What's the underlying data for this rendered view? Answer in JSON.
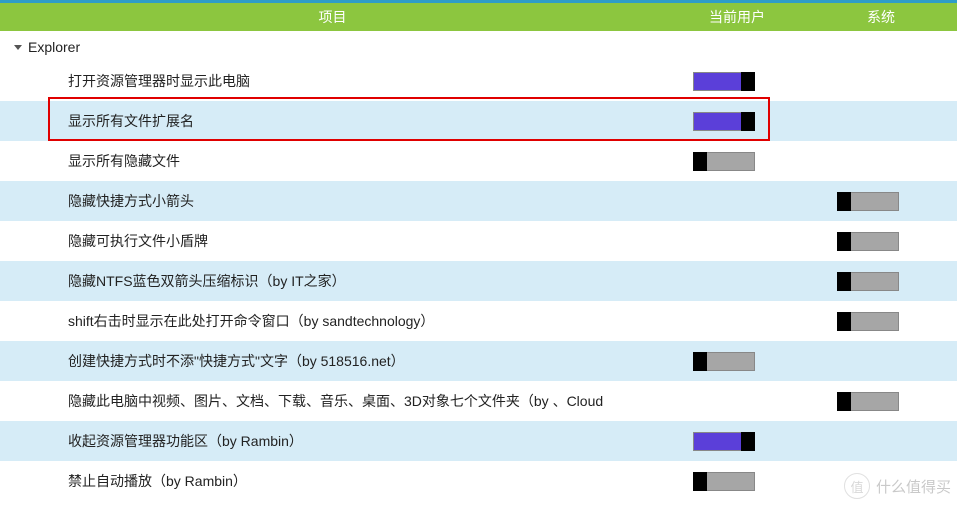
{
  "header": {
    "item": "项目",
    "user": "当前用户",
    "system": "系统"
  },
  "section": {
    "title": "Explorer"
  },
  "rows": [
    {
      "label": "打开资源管理器时显示此电脑",
      "user": "on",
      "sys": null,
      "alt": false
    },
    {
      "label": "显示所有文件扩展名",
      "user": "on",
      "sys": null,
      "alt": true
    },
    {
      "label": "显示所有隐藏文件",
      "user": "off",
      "sys": null,
      "alt": false
    },
    {
      "label": "隐藏快捷方式小箭头",
      "user": null,
      "sys": "off",
      "alt": true
    },
    {
      "label": "隐藏可执行文件小盾牌",
      "user": null,
      "sys": "off",
      "alt": false
    },
    {
      "label": "隐藏NTFS蓝色双箭头压缩标识（by IT之家）",
      "user": null,
      "sys": "off",
      "alt": true
    },
    {
      "label": "shift右击时显示在此处打开命令窗口（by sandtechnology）",
      "user": null,
      "sys": "off",
      "alt": false
    },
    {
      "label": "创建快捷方式时不添\"快捷方式\"文字（by 518516.net）",
      "user": "off",
      "sys": null,
      "alt": true
    },
    {
      "label": "隐藏此电脑中视频、图片、文档、下载、音乐、桌面、3D对象七个文件夹（by 、Cloud",
      "user": null,
      "sys": "off",
      "alt": false
    },
    {
      "label": "收起资源管理器功能区（by Rambin）",
      "user": "on",
      "sys": null,
      "alt": true
    },
    {
      "label": "禁止自动播放（by Rambin）",
      "user": "off",
      "sys": null,
      "alt": false
    }
  ],
  "highlight": {
    "row": 1
  },
  "watermark": {
    "icon": "值",
    "text": "什么值得买"
  }
}
